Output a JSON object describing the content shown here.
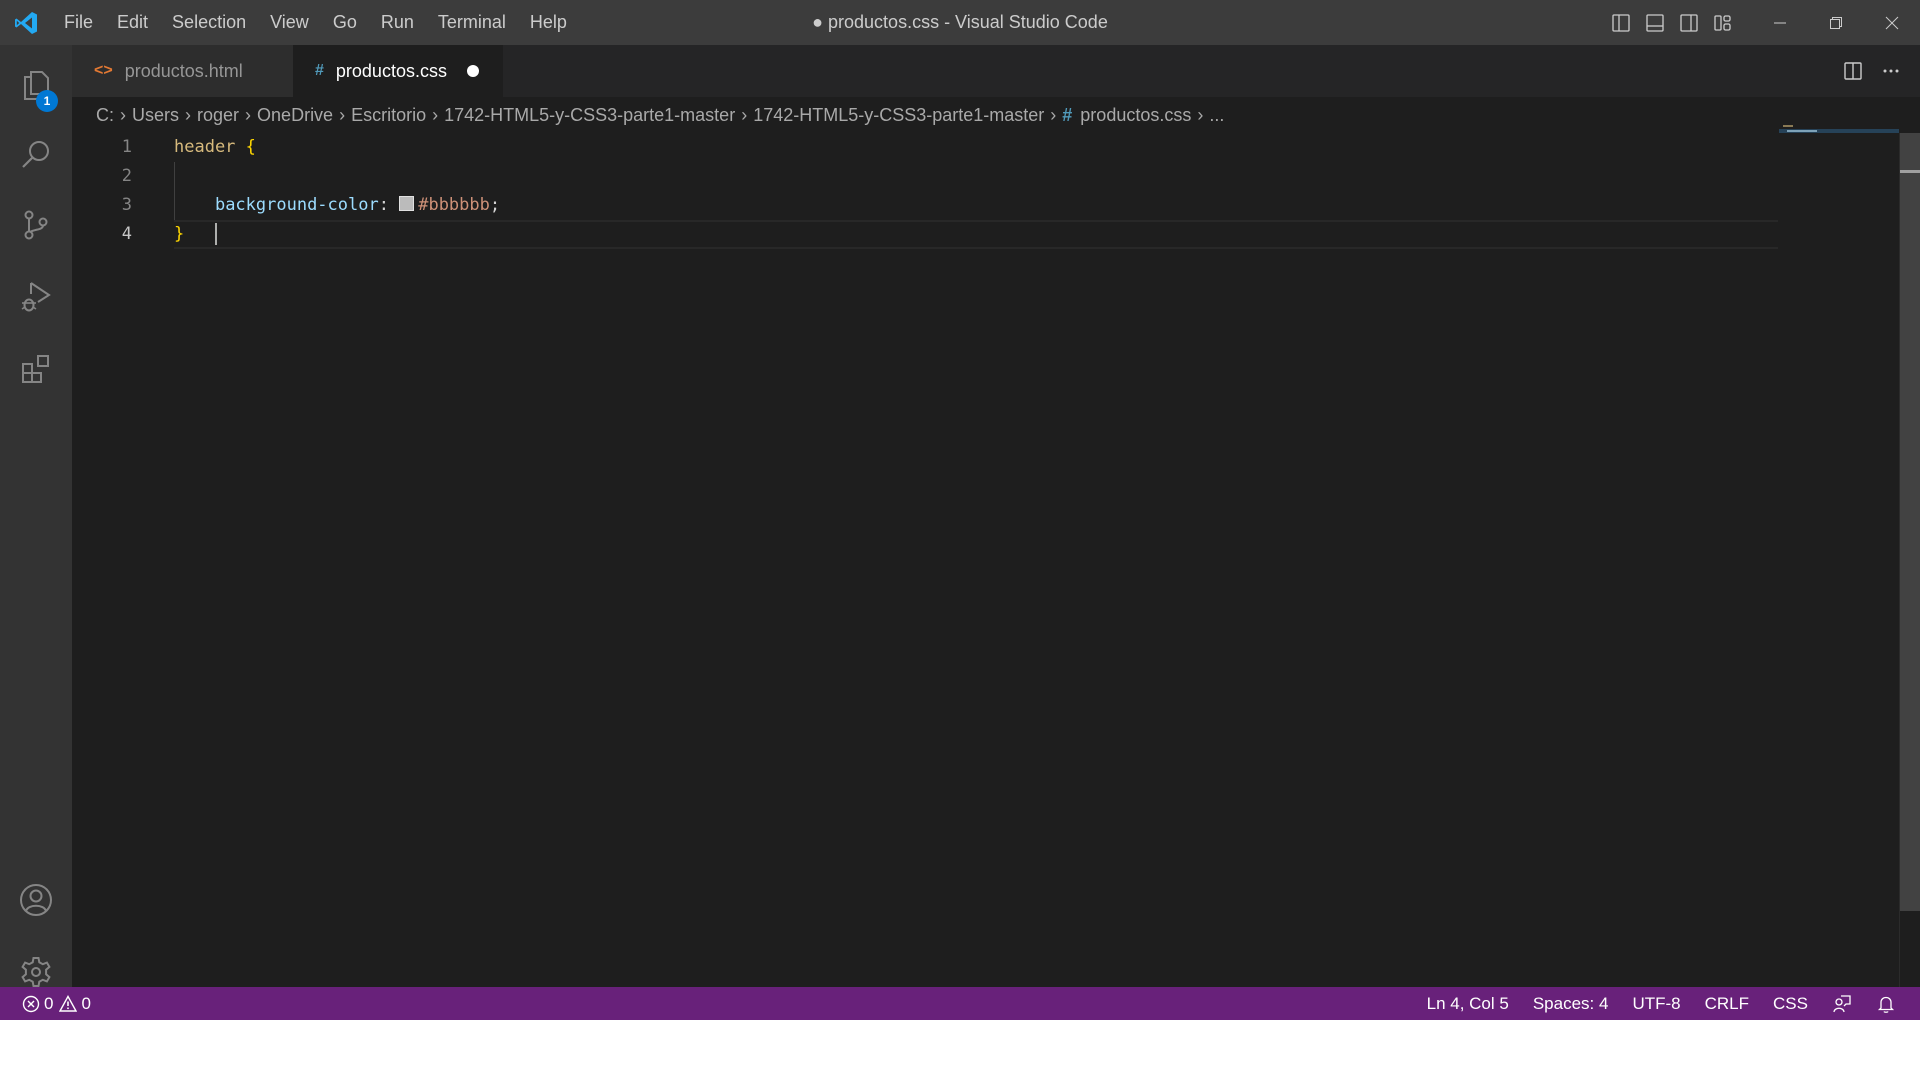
{
  "titlebar": {
    "menu": [
      "File",
      "Edit",
      "Selection",
      "View",
      "Go",
      "Run",
      "Terminal",
      "Help"
    ],
    "window_title": "● productos.css - Visual Studio Code",
    "icons": [
      "toggle-primary-sidebar-icon",
      "toggle-panel-icon",
      "toggle-secondary-sidebar-icon",
      "customize-layout-icon",
      "minimize-icon",
      "restore-icon",
      "close-icon"
    ]
  },
  "activitybar": {
    "items": [
      {
        "name": "explorer",
        "icon": "files-icon",
        "badge": "1"
      },
      {
        "name": "search",
        "icon": "search-icon"
      },
      {
        "name": "source-control",
        "icon": "source-control-icon"
      },
      {
        "name": "run-debug",
        "icon": "run-debug-icon"
      },
      {
        "name": "extensions",
        "icon": "extensions-icon"
      }
    ],
    "bottom": [
      {
        "name": "accounts",
        "icon": "account-icon"
      },
      {
        "name": "manage",
        "icon": "gear-icon"
      }
    ]
  },
  "tabs": [
    {
      "label": "productos.html",
      "icon": "<>",
      "icon_color": "#e37933",
      "active": false
    },
    {
      "label": "productos.css",
      "icon": "#",
      "icon_color": "#519aba",
      "active": true,
      "dirty": true
    }
  ],
  "breadcrumb": {
    "items": [
      "C:",
      "Users",
      "roger",
      "OneDrive",
      "Escritorio",
      "1742-HTML5-y-CSS3-parte1-master",
      "1742-HTML5-y-CSS3-parte1-master"
    ],
    "file_icon": "#",
    "file": "productos.css",
    "more": "..."
  },
  "editor": {
    "line_numbers": [
      "1",
      "2",
      "3",
      "4"
    ],
    "current_line": 4,
    "code": {
      "line1_selector": "header",
      "line1_brace": "{",
      "line3_property": "background-color",
      "line3_colon": ":",
      "line3_value": "#bbbbbb",
      "line3_semicolon": ";",
      "line4_brace": "}"
    },
    "swatch_color": "#bbbbbb"
  },
  "statusbar": {
    "errors": "0",
    "warnings": "0",
    "position": "Ln 4, Col 5",
    "indentation": "Spaces: 4",
    "encoding": "UTF-8",
    "eol": "CRLF",
    "language": "CSS",
    "color": "#68217a"
  }
}
